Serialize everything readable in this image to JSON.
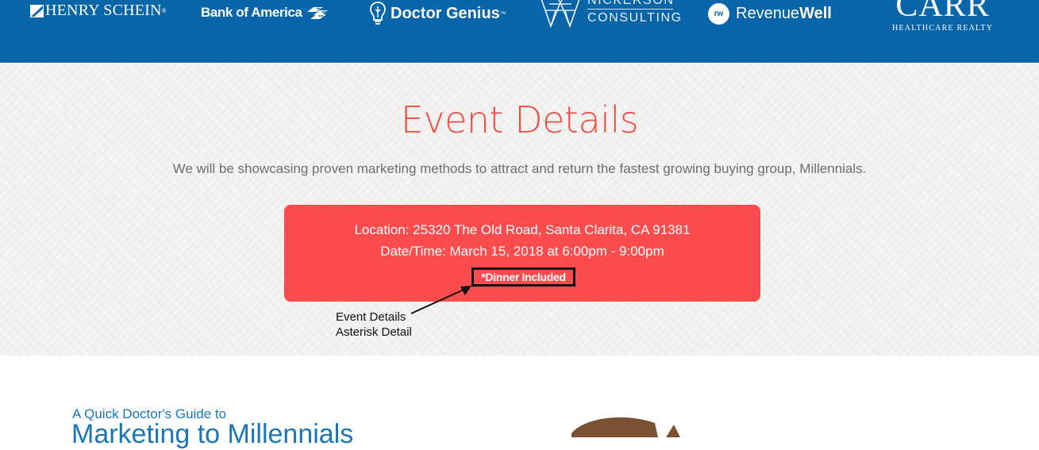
{
  "sponsors": {
    "henry_schein": {
      "name": "HENRY SCHEIN",
      "reg": "®",
      "icon": "henry-schein-mark-icon"
    },
    "bank_of_america": {
      "name": "Bank of America",
      "icon": "bank-of-america-flag-icon"
    },
    "doctor_genius": {
      "name": "Doctor Genius",
      "tm": "™",
      "icon": "lightbulb-icon"
    },
    "nickerson": {
      "line1": "NICKERSON",
      "line2": "CONSULTING",
      "icon": "nickerson-mark-icon"
    },
    "revenuewell": {
      "badge": "rw",
      "name_light": "Revenue",
      "name_bold": "Well"
    },
    "carr": {
      "name": "CARR",
      "subtitle": "HEALTHCARE REALTY"
    }
  },
  "event": {
    "title": "Event Details",
    "subtitle": "We will be showcasing proven marketing methods to attract and return the fastest growing buying group, Millennials.",
    "location": "Location: 25320 The Old Road, Santa Clarita, CA 91381",
    "datetime": "Date/Time: March 15, 2018 at 6:00pm - 9:00pm",
    "dinner": "*Dinner Included"
  },
  "annotation": {
    "line1": "Event Details",
    "line2": "Asterisk Detail"
  },
  "guide": {
    "pre_title": "A Quick Doctor's Guide to",
    "title": "Marketing to Millennials"
  },
  "colors": {
    "header_blue": "#0765a8",
    "title_red": "#ee4f43",
    "card_red": "#fd4c4d",
    "guide_blue": "#1a76b8",
    "illustration_brown": "#7a5233"
  }
}
